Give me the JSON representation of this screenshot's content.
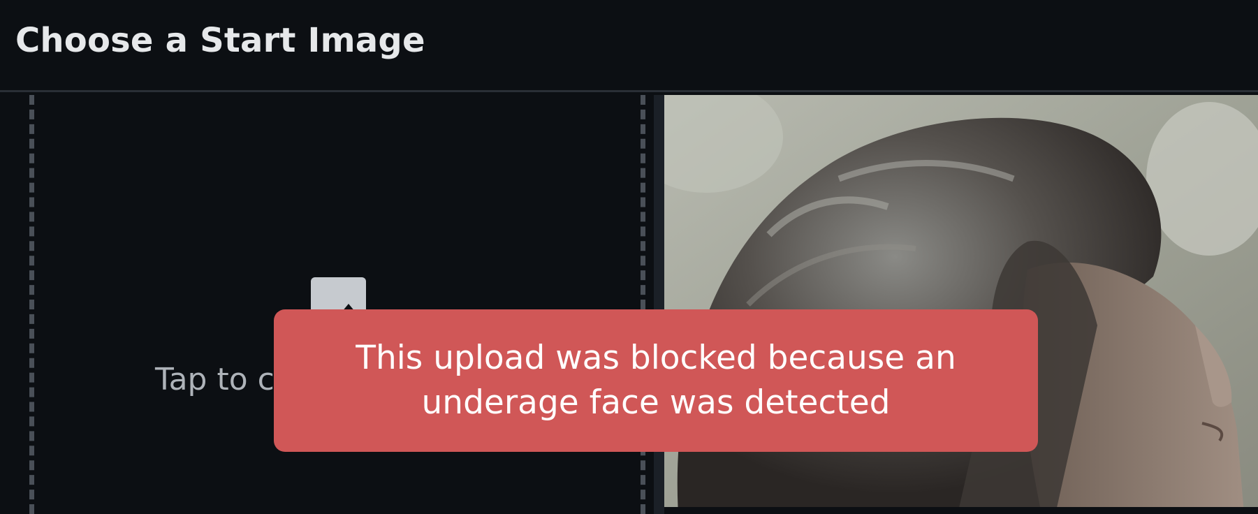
{
  "header": {
    "title": "Choose a Start Image"
  },
  "upload": {
    "prompt_text": "Tap to c",
    "icon": "upload-image-icon"
  },
  "preview": {
    "description_icon": "face-photo"
  },
  "toast": {
    "message": "This upload was blocked because an underage face was detected",
    "color": "#d05757"
  },
  "colors": {
    "background": "#0c0f13",
    "title": "#e6e8ea",
    "dashed_border": "#4a5058"
  }
}
